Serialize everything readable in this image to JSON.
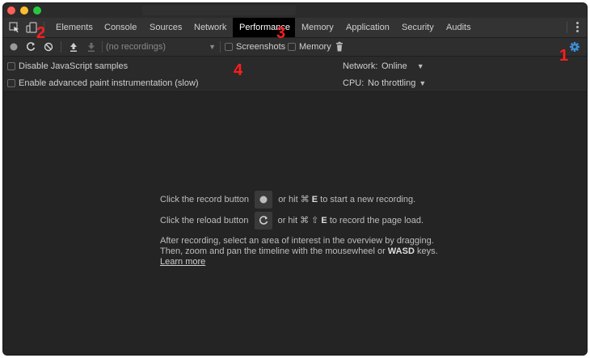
{
  "tabs": [
    {
      "label": "Elements"
    },
    {
      "label": "Console"
    },
    {
      "label": "Sources"
    },
    {
      "label": "Network"
    },
    {
      "label": "Performance"
    },
    {
      "label": "Memory"
    },
    {
      "label": "Application"
    },
    {
      "label": "Security"
    },
    {
      "label": "Audits"
    }
  ],
  "toolbar": {
    "recordings_select": "(no recordings)",
    "screenshots_label": "Screenshots",
    "memory_label": "Memory"
  },
  "settings": {
    "disable_js_samples": "Disable JavaScript samples",
    "advanced_paint": "Enable advanced paint instrumentation (slow)",
    "network_label": "Network:",
    "network_value": "Online",
    "cpu_label": "CPU:",
    "cpu_value": "No throttling"
  },
  "main": {
    "record_pre": "Click the record button",
    "record_post_1": "or hit ⌘ ",
    "record_key": "E",
    "record_post_2": " to start a new recording.",
    "reload_pre": "Click the reload button",
    "reload_post_1": "or hit ⌘ ⇧ ",
    "reload_key": "E",
    "reload_post_2": " to record the page load.",
    "after_line1": "After recording, select an area of interest in the overview by dragging.",
    "after_line2_pre": "Then, zoom and pan the timeline with the mousewheel or ",
    "after_line2_key": "WASD",
    "after_line2_post": " keys.",
    "learn_more": "Learn more"
  },
  "annotations": {
    "m1": "1",
    "m2": "2",
    "m3": "3",
    "m4": "4"
  },
  "colors": {
    "active_tab_bg": "#000000",
    "settings_gear": "#3d8fd9",
    "annotation": "#ff1d1d"
  }
}
